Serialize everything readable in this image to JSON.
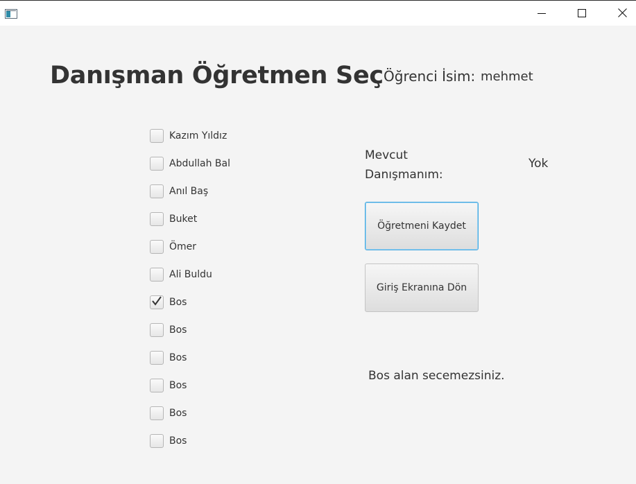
{
  "window": {
    "icons": {
      "app": "app-window-icon",
      "minimize": "minimize-icon",
      "maximize": "maximize-icon",
      "close": "close-icon"
    }
  },
  "header": {
    "title": "Danışman Öğretmen Seç",
    "student_label": "Öğrenci İsim:",
    "student_value": "mehmet"
  },
  "teachers": [
    {
      "label": "Kazım Yıldız",
      "checked": false
    },
    {
      "label": "Abdullah Bal",
      "checked": false
    },
    {
      "label": "Anıl Baş",
      "checked": false
    },
    {
      "label": "Buket",
      "checked": false
    },
    {
      "label": "Ömer",
      "checked": false
    },
    {
      "label": "Ali Buldu",
      "checked": false
    },
    {
      "label": "Bos",
      "checked": true
    },
    {
      "label": "Bos",
      "checked": false
    },
    {
      "label": "Bos",
      "checked": false
    },
    {
      "label": "Bos",
      "checked": false
    },
    {
      "label": "Bos",
      "checked": false
    },
    {
      "label": "Bos",
      "checked": false
    }
  ],
  "advisor": {
    "label_line1": "Mevcut",
    "label_line2": "Danışmanım:",
    "value": "Yok"
  },
  "buttons": {
    "save": "Öğretmeni Kaydet",
    "back": "Giriş Ekranına Dön"
  },
  "status_message": "Bos alan secemezsiniz.",
  "colors": {
    "focus": "#3fa7e0",
    "background": "#f4f4f4",
    "text": "#333333"
  }
}
